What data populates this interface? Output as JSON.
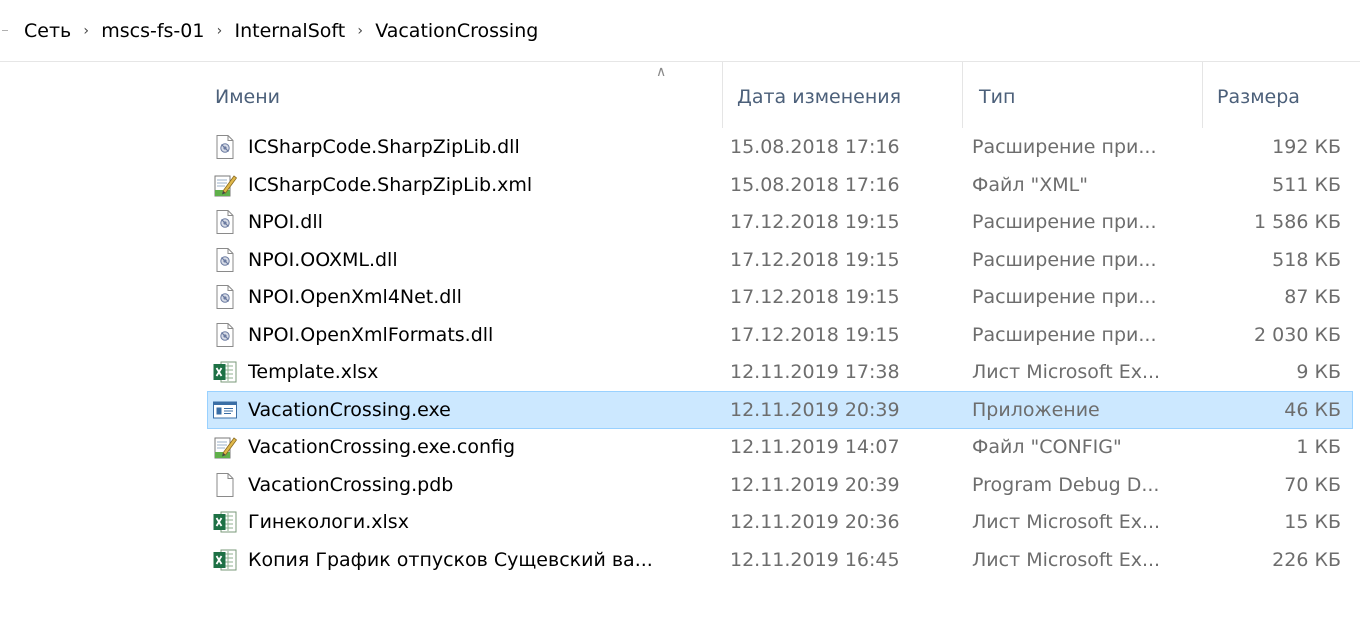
{
  "breadcrumb": [
    "Сеть",
    "mscs-fs-01",
    "InternalSoft",
    "VacationCrossing"
  ],
  "columns": {
    "name": "Имени",
    "date": "Дата изменения",
    "type": "Тип",
    "size": "Размера"
  },
  "files": [
    {
      "name": "ICSharpCode.SharpZipLib.dll",
      "date": "15.08.2018 17:16",
      "type": "Расширение при...",
      "size": "192 КБ",
      "icon": "dll-icon"
    },
    {
      "name": "ICSharpCode.SharpZipLib.xml",
      "date": "15.08.2018 17:16",
      "type": "Файл \"XML\"",
      "size": "511 КБ",
      "icon": "xml-icon"
    },
    {
      "name": "NPOI.dll",
      "date": "17.12.2018 19:15",
      "type": "Расширение при...",
      "size": "1 586 КБ",
      "icon": "dll-icon"
    },
    {
      "name": "NPOI.OOXML.dll",
      "date": "17.12.2018 19:15",
      "type": "Расширение при...",
      "size": "518 КБ",
      "icon": "dll-icon"
    },
    {
      "name": "NPOI.OpenXml4Net.dll",
      "date": "17.12.2018 19:15",
      "type": "Расширение при...",
      "size": "87 КБ",
      "icon": "dll-icon"
    },
    {
      "name": "NPOI.OpenXmlFormats.dll",
      "date": "17.12.2018 19:15",
      "type": "Расширение при...",
      "size": "2 030 КБ",
      "icon": "dll-icon"
    },
    {
      "name": "Template.xlsx",
      "date": "12.11.2019 17:38",
      "type": "Лист Microsoft Ex...",
      "size": "9 КБ",
      "icon": "excel-icon"
    },
    {
      "name": "VacationCrossing.exe",
      "date": "12.11.2019 20:39",
      "type": "Приложение",
      "size": "46 КБ",
      "icon": "exe-icon",
      "selected": true
    },
    {
      "name": "VacationCrossing.exe.config",
      "date": "12.11.2019 14:07",
      "type": "Файл \"CONFIG\"",
      "size": "1 КБ",
      "icon": "config-icon"
    },
    {
      "name": "VacationCrossing.pdb",
      "date": "12.11.2019 20:39",
      "type": "Program Debug D...",
      "size": "70 КБ",
      "icon": "file-icon"
    },
    {
      "name": "Гинекологи.xlsx",
      "date": "12.11.2019 20:36",
      "type": "Лист Microsoft Ex...",
      "size": "15 КБ",
      "icon": "excel-icon"
    },
    {
      "name": "Копия График отпусков Сущевский ва...",
      "date": "12.11.2019 16:45",
      "type": "Лист Microsoft Ex...",
      "size": "226 КБ",
      "icon": "excel-icon"
    }
  ]
}
